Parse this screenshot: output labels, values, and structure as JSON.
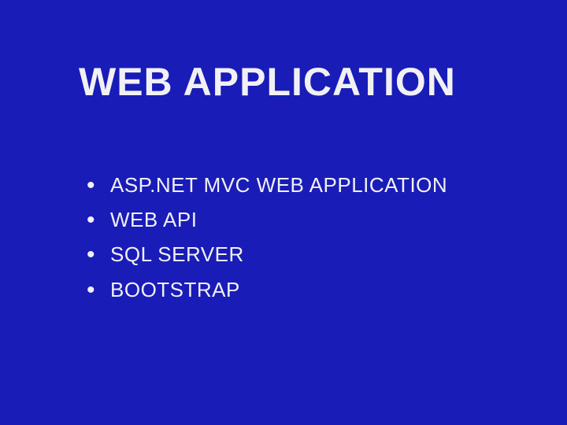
{
  "slide": {
    "title": "WEB APPLICATION",
    "items": [
      "ASP.NET MVC WEB APPLICATION",
      "WEB API",
      "SQL SERVER",
      "BOOTSTRAP"
    ]
  }
}
